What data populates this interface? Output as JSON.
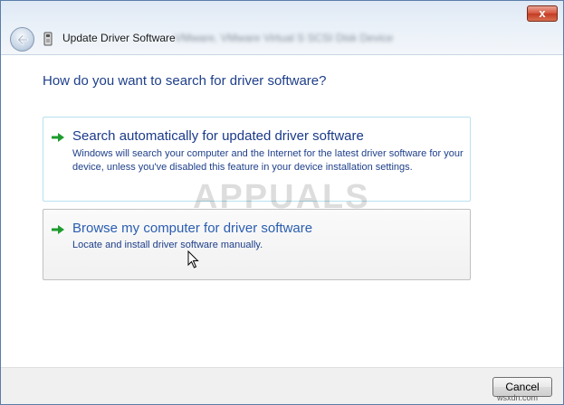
{
  "window": {
    "title": "Update Driver Software",
    "device_name": "VMware, VMware Virtual S SCSI Disk Device",
    "close_label": "x",
    "icons": {
      "back": "back-arrow-icon",
      "device": "device-icon",
      "option_arrow": "green-arrow-icon"
    }
  },
  "content": {
    "question": "How do you want to search for driver software?",
    "options": [
      {
        "title": "Search automatically for updated driver software",
        "description": "Windows will search your computer and the Internet for the latest driver software for your device, unless you've disabled this feature in your device installation settings."
      },
      {
        "title": "Browse my computer for driver software",
        "description": "Locate and install driver software manually."
      }
    ]
  },
  "footer": {
    "cancel_label": "Cancel"
  },
  "overlay": {
    "watermark": "APPUALS",
    "credit": "wsxdn.com"
  },
  "colors": {
    "text_blue": "#1e3f8a",
    "link_blue": "#2a5db0",
    "arrow_green": "#1e9b2e",
    "close_red": "#c23b22"
  }
}
